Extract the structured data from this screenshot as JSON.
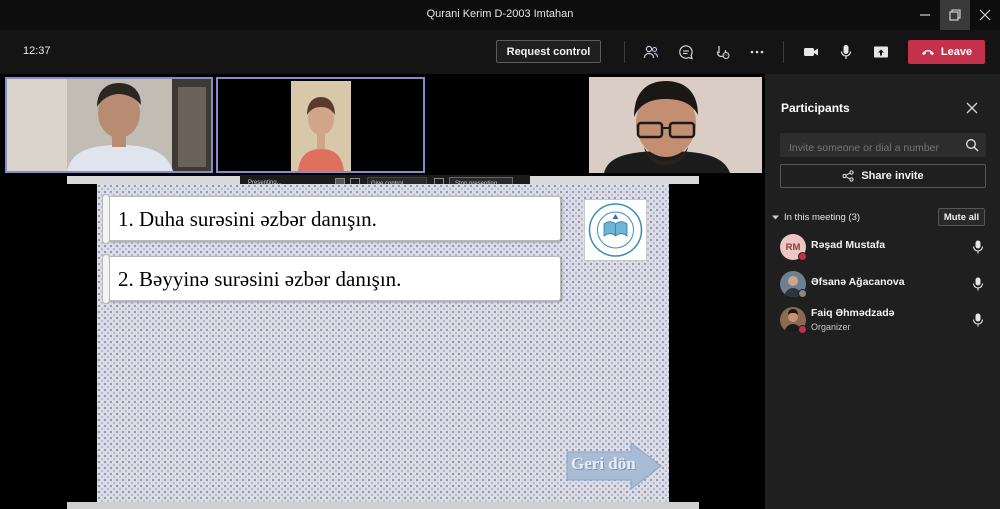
{
  "window": {
    "title": "Qurani Kerim D-2003 Imtahan"
  },
  "toolbar": {
    "clock": "12:37",
    "request_control_label": "Request control",
    "leave_label": "Leave"
  },
  "presenting_bar": {
    "status": "Presenting...",
    "give_control": "Give control",
    "stop_presenting": "Stop presenting"
  },
  "slide": {
    "items": [
      {
        "text": "1. Duha surəsini əzbər danışın."
      },
      {
        "text": "2. Bəyyinə surəsini əzbər danışın."
      }
    ],
    "back_button": "Geri dön"
  },
  "participants": {
    "title": "Participants",
    "invite_placeholder": "Invite someone or dial a number",
    "share_invite_label": "Share invite",
    "section_label": "In this meeting (3)",
    "mute_all_label": "Mute all",
    "people": [
      {
        "initials": "RM",
        "name": "Rəşad Mustafa",
        "role": "",
        "status_color": "#c4314b"
      },
      {
        "initials": "",
        "name": "Əfsanə Ağacanova",
        "role": "",
        "status_color": "#8a8886"
      },
      {
        "initials": "",
        "name": "Faiq Əhmədzadə",
        "role": "Organizer",
        "status_color": "#c4314b"
      }
    ]
  },
  "colors": {
    "accent": "#8b8cc7",
    "leave": "#c4314b",
    "panel_bg": "#1f1f1f"
  }
}
